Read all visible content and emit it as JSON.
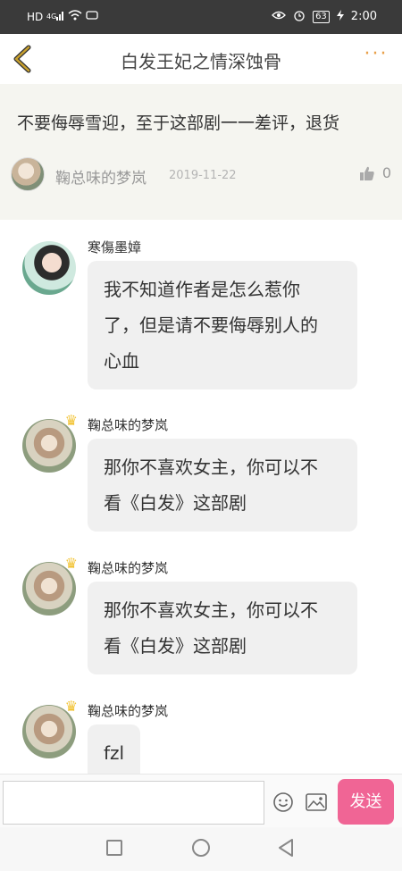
{
  "status_bar": {
    "network_left": "HD",
    "signal": "4G",
    "battery": "63",
    "time": "2:00"
  },
  "header": {
    "title": "白发王妃之情深蚀骨",
    "back_icon": "chevron-left-icon",
    "more_icon": "more-dots-icon",
    "more_glyph": "···",
    "accent_color": "#e8a04a"
  },
  "review": {
    "text": "不要侮辱雪迎，至于这部剧一一差评，退货",
    "author": "鞠总味的梦岚",
    "date": "2019-11-22",
    "likes": "0"
  },
  "messages": [
    {
      "author": "寒傷墨嫜",
      "lines": [
        "我不知道作者是怎么惹你",
        "了，但是请不要侮辱别人的",
        "心血"
      ]
    },
    {
      "author": "鞠总味的梦岚",
      "lines": [
        "那你不喜欢女主，你可以不",
        "看《白发》这部剧"
      ]
    },
    {
      "author": "鞠总味的梦岚",
      "lines": [
        "那你不喜欢女主，你可以不",
        "看《白发》这部剧"
      ]
    },
    {
      "author": "鞠总味的梦岚",
      "lines": [
        "fzl"
      ]
    }
  ],
  "input_bar": {
    "placeholder": "",
    "send_label": "发送",
    "send_color": "#f06595"
  }
}
